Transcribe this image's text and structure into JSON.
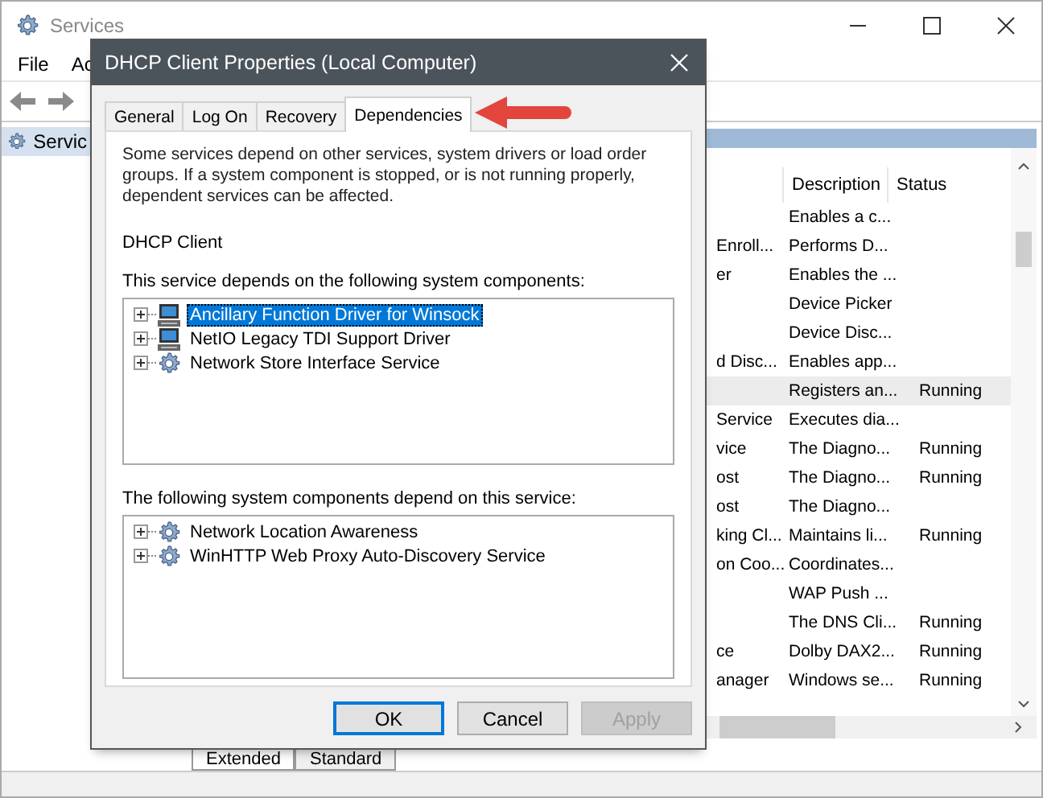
{
  "window": {
    "title": "Services"
  },
  "menu": [
    "File",
    "Ac"
  ],
  "tree": [
    {
      "label": "Servic",
      "selected": true
    }
  ],
  "columns": [
    "Description",
    "Status"
  ],
  "rows": [
    {
      "name": "",
      "description": "Enables a c...",
      "status": "",
      "selected": false
    },
    {
      "name": "Enroll...",
      "description": "Performs D...",
      "status": "",
      "selected": false
    },
    {
      "name": "er",
      "description": "Enables the ...",
      "status": "",
      "selected": false
    },
    {
      "name": "",
      "description": "Device Picker",
      "status": "",
      "selected": false
    },
    {
      "name": "",
      "description": "Device Disc...",
      "status": "",
      "selected": false
    },
    {
      "name": "d Disc...",
      "description": "Enables app...",
      "status": "",
      "selected": false
    },
    {
      "name": "",
      "description": "Registers an...",
      "status": "Running",
      "selected": true
    },
    {
      "name": "Service",
      "description": "Executes dia...",
      "status": "",
      "selected": false
    },
    {
      "name": "vice",
      "description": "The Diagno...",
      "status": "Running",
      "selected": false
    },
    {
      "name": "ost",
      "description": "The Diagno...",
      "status": "Running",
      "selected": false
    },
    {
      "name": "ost",
      "description": "The Diagno...",
      "status": "",
      "selected": false
    },
    {
      "name": "king Cl...",
      "description": "Maintains li...",
      "status": "Running",
      "selected": false
    },
    {
      "name": "on Coo...",
      "description": "Coordinates...",
      "status": "",
      "selected": false
    },
    {
      "name": "",
      "description": "WAP Push ...",
      "status": "",
      "selected": false
    },
    {
      "name": "",
      "description": "The DNS Cli...",
      "status": "Running",
      "selected": false
    },
    {
      "name": "ce",
      "description": "Dolby DAX2...",
      "status": "Running",
      "selected": false
    },
    {
      "name": "anager",
      "description": "Windows se...",
      "status": "Running",
      "selected": false
    }
  ],
  "view_tabs": [
    {
      "label": "Extended",
      "selected": false
    },
    {
      "label": "Standard",
      "selected": true
    }
  ],
  "dialog": {
    "title": "DHCP Client Properties (Local Computer)",
    "tabs": [
      {
        "label": "General",
        "selected": false
      },
      {
        "label": "Log On",
        "selected": false
      },
      {
        "label": "Recovery",
        "selected": false
      },
      {
        "label": "Dependencies",
        "selected": true
      }
    ],
    "intro": "Some services depend on other services, system drivers or load order groups. If a system component is stopped, or is not running properly, dependent services can be affected.",
    "service_name": "DHCP Client",
    "depends_on_label": "This service depends on the following system components:",
    "depends_on": [
      {
        "label": "Ancillary Function Driver for Winsock",
        "kind": "driver",
        "selected": true
      },
      {
        "label": "NetIO Legacy TDI Support Driver",
        "kind": "driver",
        "selected": false
      },
      {
        "label": "Network Store Interface Service",
        "kind": "service",
        "selected": false
      }
    ],
    "dependents_label": "The following system components depend on this service:",
    "dependents": [
      {
        "label": "Network Location Awareness",
        "kind": "service",
        "selected": false
      },
      {
        "label": "WinHTTP Web Proxy Auto-Discovery Service",
        "kind": "service",
        "selected": false
      }
    ],
    "buttons": [
      {
        "label": "OK",
        "default": true,
        "disabled": false
      },
      {
        "label": "Cancel",
        "default": false,
        "disabled": false
      },
      {
        "label": "Apply",
        "default": false,
        "disabled": true
      }
    ]
  }
}
